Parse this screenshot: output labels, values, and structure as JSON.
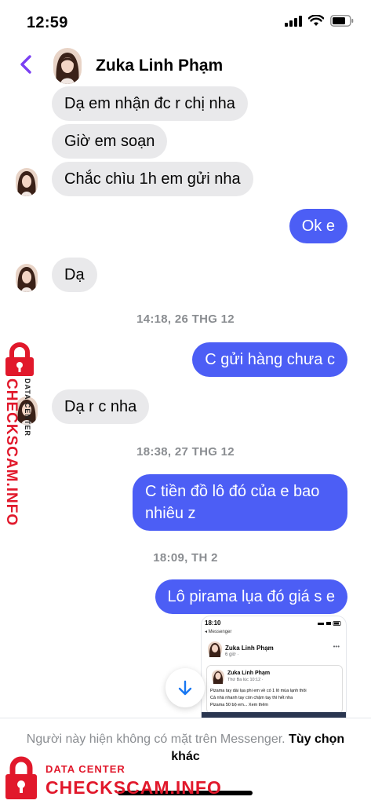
{
  "status_bar": {
    "time": "12:59"
  },
  "header": {
    "contact_name": "Zuka Linh Phạm"
  },
  "messages": [
    {
      "text": "Dạ em nhận đc r chị nha"
    },
    {
      "text": "Giờ em soạn"
    },
    {
      "text": "Chắc chìu 1h em gửi nha"
    },
    {
      "text": "Ok e"
    },
    {
      "text": "Dạ"
    },
    {
      "text": "C gửi hàng chưa c"
    },
    {
      "text": "Dạ r c nha"
    },
    {
      "text": "C tiền đồ lô đó của e bao nhiêu z"
    },
    {
      "text": "Lô pirama lụa đó giá s e"
    }
  ],
  "timestamps": [
    "14:18, 26 THG 12",
    "18:38, 27 THG 12",
    "18:09, TH 2"
  ],
  "shared_image": {
    "time": "18:10",
    "back": "◂ Messenger",
    "post_name": "Zuka Linh Phạm",
    "post_sub": "6 giờ · ",
    "inner_name": "Zuka Linh Phạm",
    "inner_sub": "Thứ Ba lúc 10:12 · ",
    "lines": [
      "Pizama tay dài lụa phi em về có 1 lô mùa lạnh thôi",
      "Cả nhà nhanh tay còn chậm tay thì hết nha",
      "Pizama 50 bộ em... Xem thêm"
    ]
  },
  "footer": {
    "notice": "Người này hiện không có mặt trên Messenger.",
    "link": "Tùy chọn khác"
  },
  "watermark": {
    "side_main": "CHECKSCAM.INFO",
    "side_sub": "DATA CENTER",
    "bottom_sub": "DATA CENTER",
    "bottom_main": "CHECKSCAM.INFO"
  },
  "colors": {
    "outgoing_bubble": "#4c5ef5",
    "incoming_bubble": "#e9e9eb",
    "accent": "#7b40f2",
    "watermark_red": "#e1182b"
  },
  "icons": [
    "signal-icon",
    "wifi-icon",
    "battery-icon",
    "back-chevron-icon",
    "arrow-down-icon",
    "lock-icon"
  ]
}
